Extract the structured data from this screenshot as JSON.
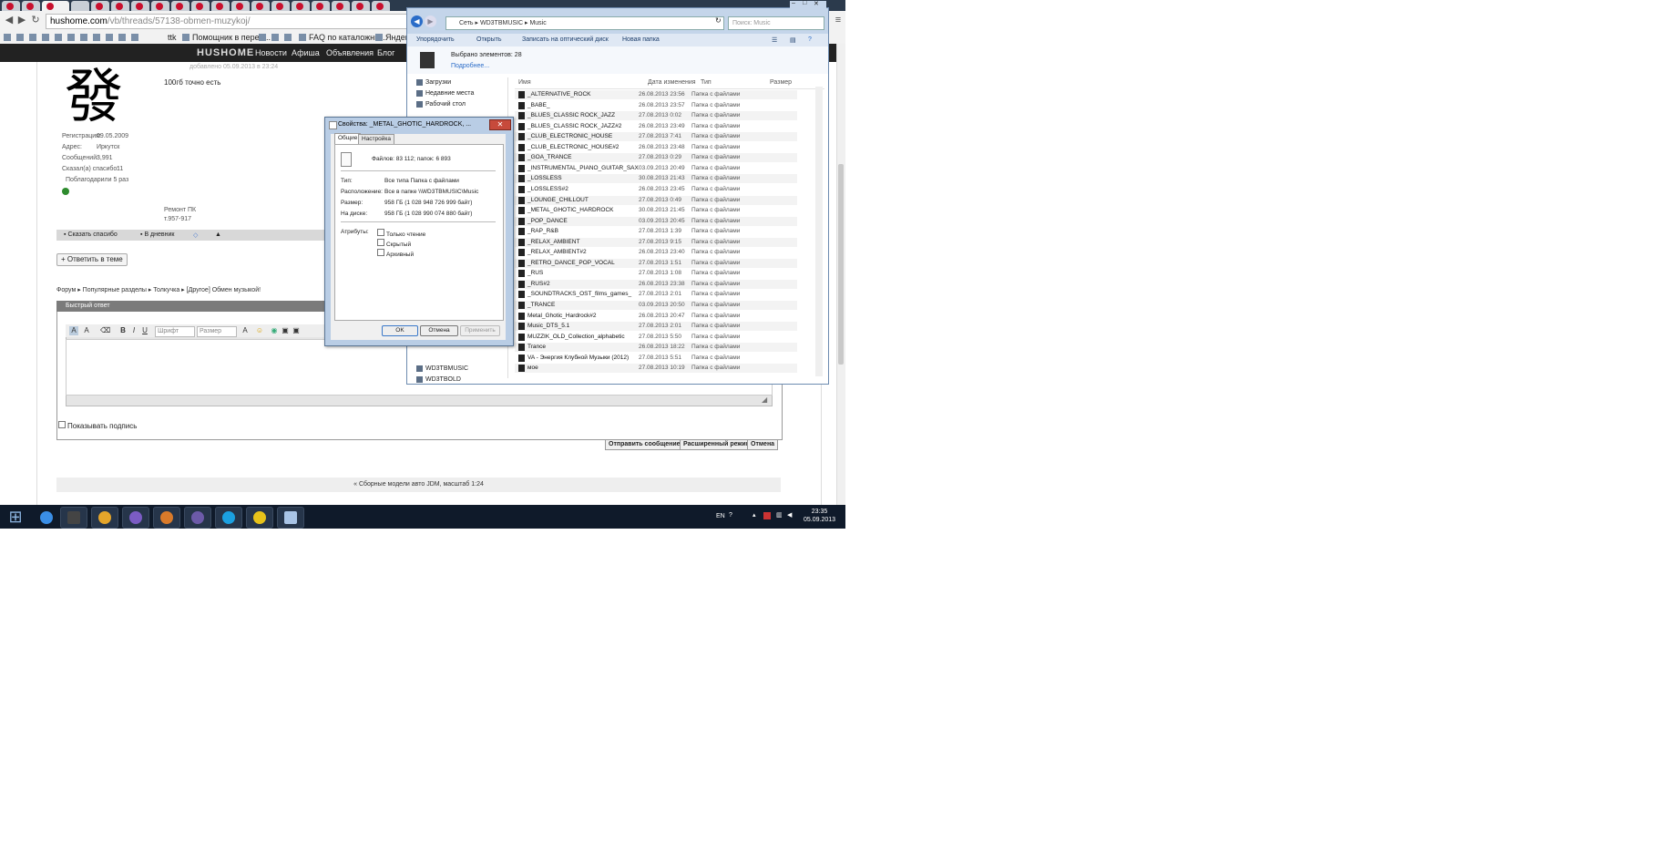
{
  "browser": {
    "url_host": "hushome.com",
    "url_path": "/vb/threads/57138-obmen-muzykoj/",
    "bookmarks": [
      "Помощник в перев...",
      "FAQ по каталожны...",
      "Яндекс"
    ],
    "bookmark_ttk": "ttk"
  },
  "site": {
    "logo": "HUSHOME",
    "nav": [
      "Новости",
      "Афиша",
      "Объявления",
      "Блог"
    ]
  },
  "post": {
    "meta": "добавлено 05.09.2013 в 23:24",
    "text": "100гб точно есть",
    "avatar_glyph": "發",
    "user_info": [
      {
        "label": "Регистрация:",
        "value": "09.05.2009"
      },
      {
        "label": "Адрес:",
        "value": "Иркутск"
      },
      {
        "label": "Сообщений:",
        "value": "3,991"
      },
      {
        "label": "Сказал(а) спасибо:",
        "value": "11"
      }
    ],
    "thanked": "Поблагодарили 5 раз",
    "signature_line1": "Ремонт ПК",
    "signature_line2": "т.957-917",
    "thanks_button": "Сказать спасибо",
    "diary_button": "В дневник"
  },
  "thread": {
    "reply_button": "+ Ответить в теме",
    "breadcrumb": [
      "Форум",
      "Популярные разделы",
      "Толкучка",
      "[Другое] Обмен музыкой!"
    ],
    "quick_reply_title": "Быстрый ответ",
    "font_placeholder": "Шрифт",
    "size_placeholder": "Размер",
    "show_signature": "Показывать подпись",
    "send_button": "Отправить сообщение",
    "advanced_button": "Расширенный режим",
    "cancel_button": "Отмена",
    "prev_thread": "« Сборные модели авто JDM, масштаб 1:24"
  },
  "explorer": {
    "path": [
      "Сеть",
      "WD3TBMUSIC",
      "Music"
    ],
    "search_placeholder": "Поиск: Music",
    "commands": [
      "Упорядочить",
      "Открыть",
      "Записать на оптический диск",
      "Новая папка"
    ],
    "selected": "Выбрано элементов: 28",
    "more": "Подробнее...",
    "nav_top": [
      "Загрузки",
      "Недавние места",
      "Рабочий стол"
    ],
    "nav_bottom": [
      "WD3TBMUSIC",
      "WD3TBOLD"
    ],
    "columns": [
      "Имя",
      "Дата изменения",
      "Тип",
      "Размер"
    ],
    "files": [
      {
        "name": "_ALTERNATIVE_ROCK",
        "date": "26.08.2013 23:56",
        "type": "Папка с файлами"
      },
      {
        "name": "_BABE_",
        "date": "26.08.2013 23:57",
        "type": "Папка с файлами"
      },
      {
        "name": "_BLUES_CLASSIC ROCK_JAZZ",
        "date": "27.08.2013 0:02",
        "type": "Папка с файлами"
      },
      {
        "name": "_BLUES_CLASSIC ROCK_JAZZ#2",
        "date": "26.08.2013 23:49",
        "type": "Папка с файлами"
      },
      {
        "name": "_CLUB_ELECTRONIC_HOUSE",
        "date": "27.08.2013 7:41",
        "type": "Папка с файлами"
      },
      {
        "name": "_CLUB_ELECTRONIC_HOUSE#2",
        "date": "26.08.2013 23:48",
        "type": "Папка с файлами"
      },
      {
        "name": "_GOA_TRANCE",
        "date": "27.08.2013 0:29",
        "type": "Папка с файлами"
      },
      {
        "name": "_INSTRUMENTAL_PIANO_GUITAR_SAX",
        "date": "03.09.2013 20:49",
        "type": "Папка с файлами"
      },
      {
        "name": "_LOSSLESS",
        "date": "30.08.2013 21:43",
        "type": "Папка с файлами"
      },
      {
        "name": "_LOSSLESS#2",
        "date": "26.08.2013 23:45",
        "type": "Папка с файлами"
      },
      {
        "name": "_LOUNGE_CHILLOUT",
        "date": "27.08.2013 0:49",
        "type": "Папка с файлами"
      },
      {
        "name": "_METAL_GHOTIC_HARDROCK",
        "date": "30.08.2013 21:45",
        "type": "Папка с файлами"
      },
      {
        "name": "_POP_DANCE",
        "date": "03.09.2013 20:45",
        "type": "Папка с файлами"
      },
      {
        "name": "_RAP_R&B",
        "date": "27.08.2013 1:39",
        "type": "Папка с файлами"
      },
      {
        "name": "_RELAX_AMBIENT",
        "date": "27.08.2013 9:15",
        "type": "Папка с файлами"
      },
      {
        "name": "_RELAX_AMBIENT#2",
        "date": "26.08.2013 23:40",
        "type": "Папка с файлами"
      },
      {
        "name": "_RETRO_DANCE_POP_VOCAL",
        "date": "27.08.2013 1:51",
        "type": "Папка с файлами"
      },
      {
        "name": "_RUS",
        "date": "27.08.2013 1:08",
        "type": "Папка с файлами"
      },
      {
        "name": "_RUS#2",
        "date": "26.08.2013 23:38",
        "type": "Папка с файлами"
      },
      {
        "name": "_SOUNDTRACKS_OST_films_games_",
        "date": "27.08.2013 2:01",
        "type": "Папка с файлами"
      },
      {
        "name": "_TRANCE",
        "date": "03.09.2013 20:50",
        "type": "Папка с файлами"
      },
      {
        "name": "Metal_Ghotic_Hardrock#2",
        "date": "26.08.2013 20:47",
        "type": "Папка с файлами"
      },
      {
        "name": "Music_DTS_5.1",
        "date": "27.08.2013 2:01",
        "type": "Папка с файлами"
      },
      {
        "name": "MUZZIK_OLD_Collection_alphabetic",
        "date": "27.08.2013 5:50",
        "type": "Папка с файлами"
      },
      {
        "name": "Trance",
        "date": "26.08.2013 18:22",
        "type": "Папка с файлами"
      },
      {
        "name": "VA - Энергия Клубной Музыки (2012)",
        "date": "27.08.2013 5:51",
        "type": "Папка с файлами"
      },
      {
        "name": "мое",
        "date": "27.08.2013 10:19",
        "type": "Папка с файлами"
      }
    ]
  },
  "dialog": {
    "title": "Свойства: _METAL_GHOTIC_HARDROCK, ...",
    "tabs": [
      "Общие",
      "Настройка"
    ],
    "counts": "Файлов: 83 112; папок: 6 893",
    "rows": [
      {
        "label": "Тип:",
        "value": "Все типа Папка с файлами"
      },
      {
        "label": "Расположение:",
        "value": "Все в папке \\\\WD3TBMUSIC\\Music"
      },
      {
        "label": "Размер:",
        "value": "958 ГБ (1 028 948 726 999 байт)"
      },
      {
        "label": "На диске:",
        "value": "958 ГБ (1 028 990 074 880 байт)"
      }
    ],
    "attributes_label": "Атрибуты:",
    "attributes": [
      "Только чтение",
      "Скрытый",
      "Архивный"
    ],
    "ok": "OK",
    "cancel": "Отмена",
    "apply": "Применить"
  },
  "taskbar": {
    "lang": "EN",
    "time": "23:35",
    "date": "05.09.2013"
  },
  "colors": {
    "taskbar": "#0f1a2a",
    "explorer_frame": "#c4d5ea",
    "site_nav": "#222222",
    "tab_favicon": "#c8102e"
  }
}
